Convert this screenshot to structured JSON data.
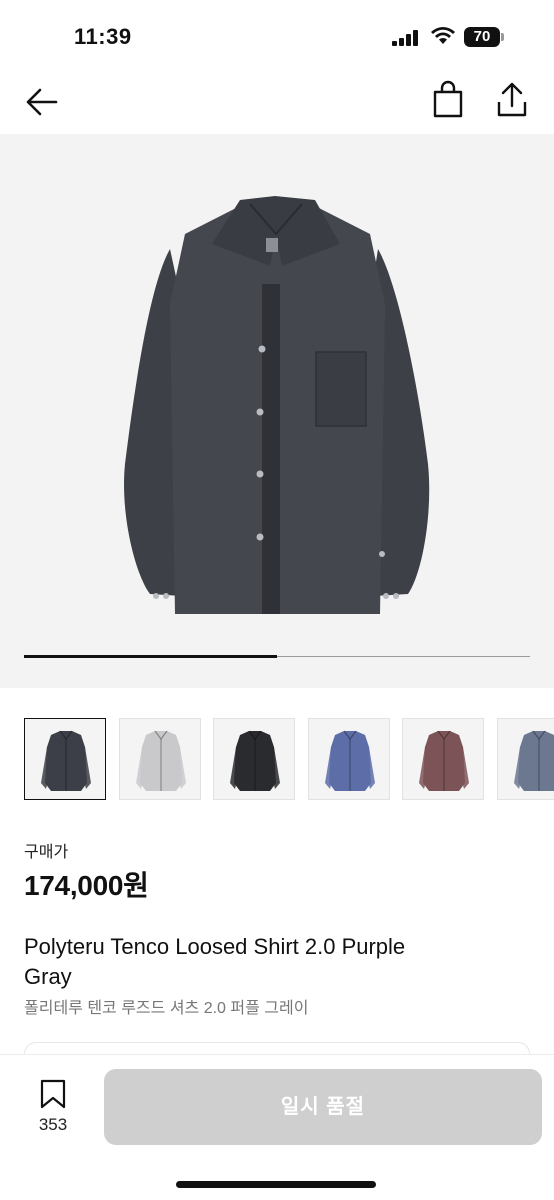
{
  "status_bar": {
    "time": "11:39",
    "battery": "70"
  },
  "header": {
    "back_icon": "arrow-left-icon",
    "bag_icon": "shopping-bag-icon",
    "share_icon": "share-icon"
  },
  "gallery": {
    "progress": 0.5
  },
  "thumbnails": [
    {
      "color_name": "dark-gray",
      "color": "#3c3f47"
    },
    {
      "color_name": "light-gray",
      "color": "#c9c9cc"
    },
    {
      "color_name": "black",
      "color": "#2a2b2e"
    },
    {
      "color_name": "blue",
      "color": "#5c6da8"
    },
    {
      "color_name": "brown",
      "color": "#7c5457"
    },
    {
      "color_name": "slate-blue",
      "color": "#6b7890"
    }
  ],
  "price": {
    "label": "구매가",
    "value": "174,000원"
  },
  "product": {
    "title_en": "Polyteru Tenco Loosed Shirt 2.0 Purple Gray",
    "title_ko": "폴리테루 텐코 루즈드 셔츠 2.0 퍼플 그레이"
  },
  "bottom_bar": {
    "bookmark_count": "353",
    "soldout_label": "일시 품절"
  }
}
